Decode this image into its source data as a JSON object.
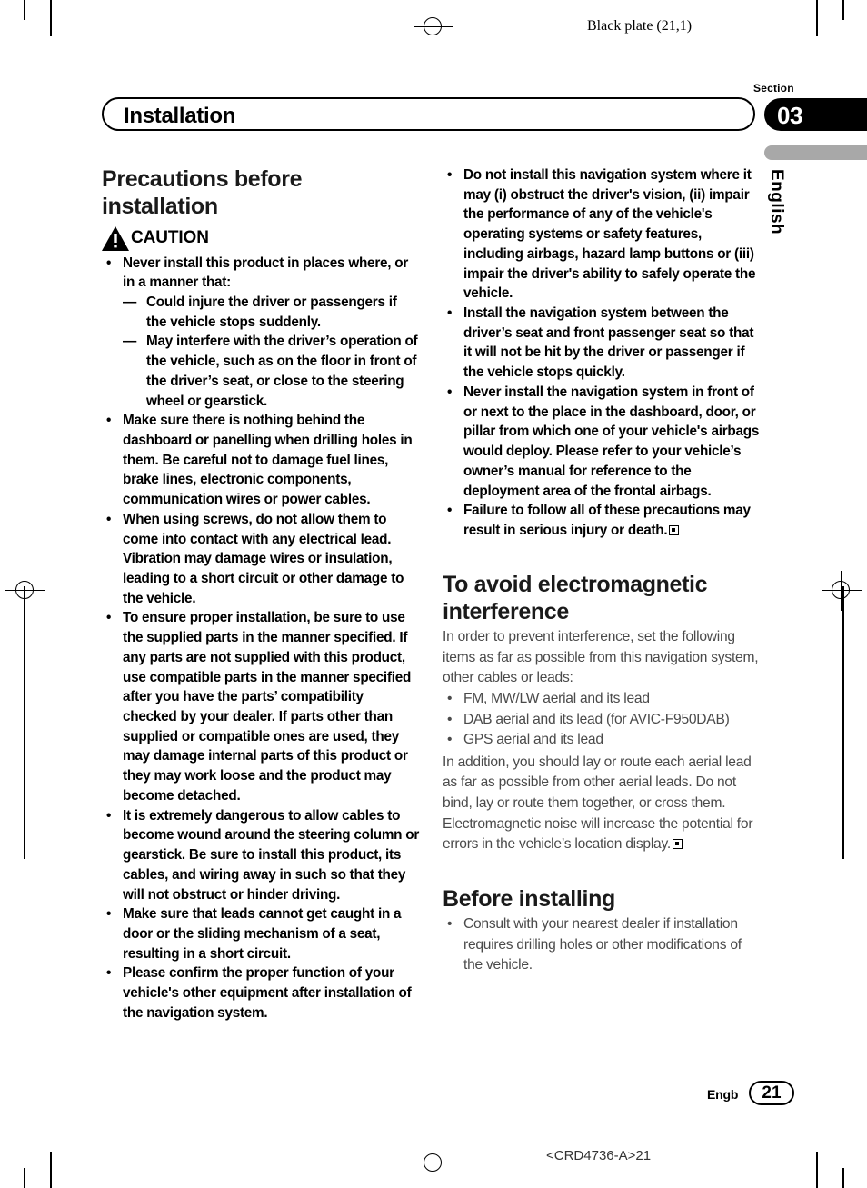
{
  "page": {
    "black_plate": "Black plate (21,1)",
    "section_label": "Section",
    "section_number": "03",
    "language_tab": "English",
    "chapter_title": "Installation",
    "footer_language": "Engb",
    "footer_page_number": "21",
    "footer_code": "<CRD4736-A>21",
    "colors": {
      "section_tab_bg": "#000000",
      "language_bar_bg": "#a8a8a8",
      "body_text": "#4a4a4a",
      "warning_text": "#000000"
    }
  },
  "left_column": {
    "heading": "Precautions before installation",
    "caution_word": "CAUTION",
    "warnings": [
      {
        "text": "Never install this product in places where, or in a manner that:",
        "sub_items": [
          "Could injure the driver or passengers if the vehicle stops suddenly.",
          "May interfere with the driver’s operation of the vehicle, such as on the floor in front of the driver’s seat, or close to the steering wheel or gearstick."
        ]
      },
      {
        "text": "Make sure there is nothing behind the dashboard or panelling when drilling holes in them. Be careful not to damage fuel lines, brake lines, electronic components, communication wires or power cables."
      },
      {
        "text": "When using screws, do not allow them to come into contact with any electrical lead. Vibration may damage wires or insulation, leading to a short circuit or other damage to the vehicle."
      },
      {
        "text": "To ensure proper installation, be sure to use the supplied parts in the manner specified. If any parts are not supplied with this product, use compatible parts in the manner specified after you have the parts’ compatibility checked by your dealer. If parts other than supplied or compatible ones are used, they may damage internal parts of this product or they may work loose and the product may become detached."
      },
      {
        "text": "It is extremely dangerous to allow cables to become wound around the steering column or gearstick. Be sure to install this product, its cables, and wiring away in such so that they will not obstruct or hinder driving."
      },
      {
        "text": "Make sure that leads cannot get caught in a door or the sliding mechanism of a seat, resulting in a short circuit."
      },
      {
        "text": "Please confirm the proper function of your vehicle's other equipment after installation of the navigation system."
      }
    ]
  },
  "right_column": {
    "warnings": [
      {
        "text": "Do not install this navigation system where it may (i) obstruct the driver's vision, (ii) impair the performance of any of the vehicle's operating systems or safety features, including airbags, hazard lamp buttons or (iii) impair the driver's ability to safely operate the vehicle."
      },
      {
        "text": "Install the navigation system between the driver’s seat and front passenger seat so that it will not be hit by the driver or passenger if the vehicle stops quickly."
      },
      {
        "text": "Never install the navigation system in front of or next to the place in the dashboard, door, or pillar from which one of your vehicle's airbags would deploy. Please refer to your vehicle’s owner’s manual for reference to the deployment area of the frontal airbags."
      },
      {
        "text": "Failure to follow all of these precautions may result in serious injury or death.",
        "end_mark": true
      }
    ],
    "emi_heading": "To avoid electromagnetic interference",
    "emi_intro": "In order to prevent interference, set the following items as far as possible from this navigation system, other cables or leads:",
    "emi_items": [
      "FM, MW/LW aerial and its lead",
      "DAB aerial and its lead (for AVIC-F950DAB)",
      "GPS aerial and its lead"
    ],
    "emi_outro": "In addition, you should lay or route each aerial lead as far as possible from other aerial leads. Do not bind, lay or route them together, or cross them. Electromagnetic noise will increase the potential for errors in the vehicle’s location display.",
    "before_heading": "Before installing",
    "before_items": [
      "Consult with your nearest dealer if installation requires drilling holes or other modifications of the vehicle."
    ]
  }
}
